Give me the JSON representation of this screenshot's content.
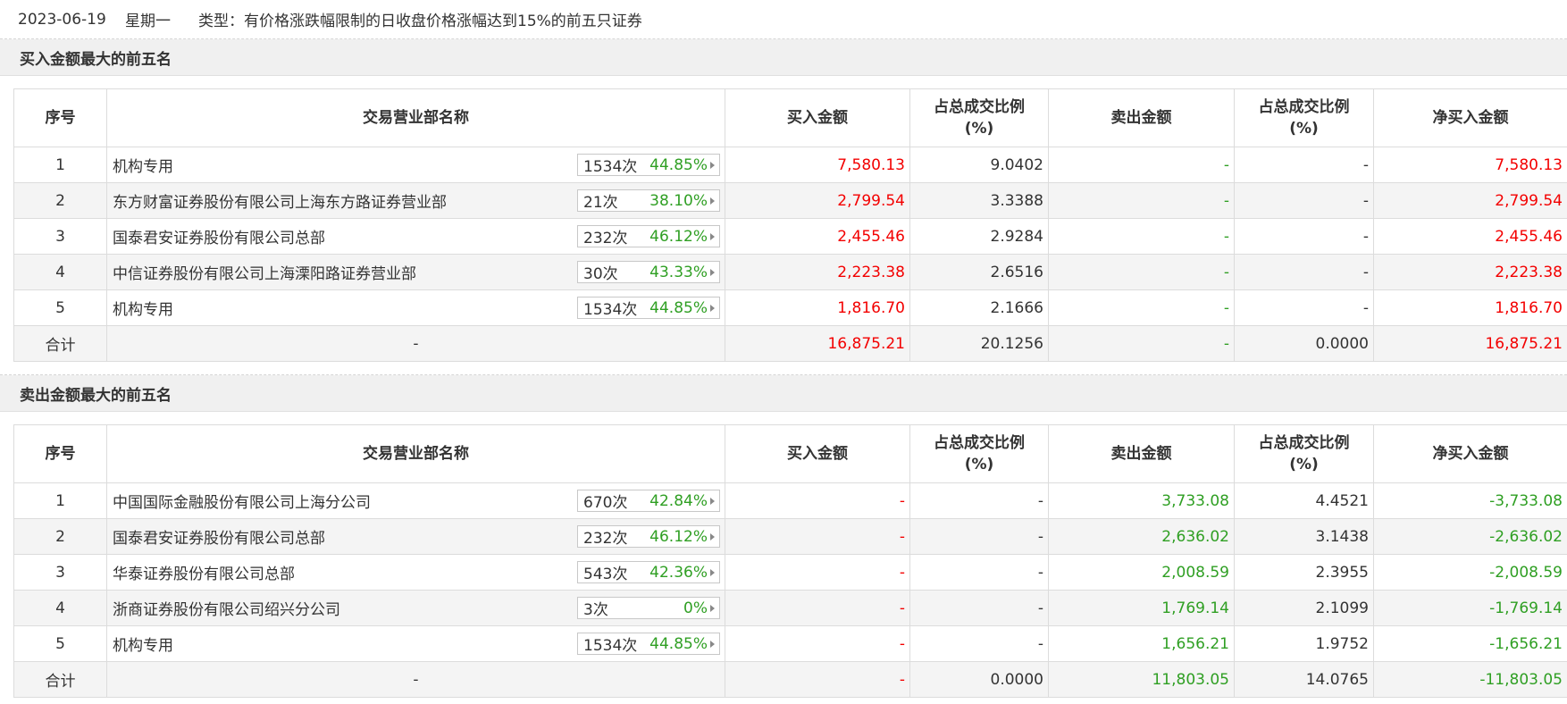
{
  "header": {
    "date": "2023-06-19",
    "weekday": "星期一",
    "type_text": "类型：有价格涨跌幅限制的日收盘价格涨幅达到15%的前五只证券"
  },
  "columns": {
    "seq": "序号",
    "name": "交易营业部名称",
    "buy": "买入金额",
    "buy_ratio_l1": "占总成交比例",
    "buy_ratio_l2": "(%)",
    "sell": "卖出金额",
    "sell_ratio_l1": "占总成交比例",
    "sell_ratio_l2": "(%)",
    "net": "净买入金额"
  },
  "colors": {
    "red": "#f30000",
    "green": "#2f9f23",
    "header_bg": "#f0f0f0"
  },
  "buy_section": {
    "title": "买入金额最大的前五名",
    "rows": [
      {
        "seq": "1",
        "name": "机构专用",
        "count": "1534次",
        "rate": "44.85%",
        "buy": "7,580.13",
        "buy_ratio": "9.0402",
        "sell": "-",
        "sell_ratio": "-",
        "net": "7,580.13"
      },
      {
        "seq": "2",
        "name": "东方财富证券股份有限公司上海东方路证券营业部",
        "count": "21次",
        "rate": "38.10%",
        "buy": "2,799.54",
        "buy_ratio": "3.3388",
        "sell": "-",
        "sell_ratio": "-",
        "net": "2,799.54"
      },
      {
        "seq": "3",
        "name": "国泰君安证券股份有限公司总部",
        "count": "232次",
        "rate": "46.12%",
        "buy": "2,455.46",
        "buy_ratio": "2.9284",
        "sell": "-",
        "sell_ratio": "-",
        "net": "2,455.46"
      },
      {
        "seq": "4",
        "name": "中信证券股份有限公司上海溧阳路证券营业部",
        "count": "30次",
        "rate": "43.33%",
        "buy": "2,223.38",
        "buy_ratio": "2.6516",
        "sell": "-",
        "sell_ratio": "-",
        "net": "2,223.38"
      },
      {
        "seq": "5",
        "name": "机构专用",
        "count": "1534次",
        "rate": "44.85%",
        "buy": "1,816.70",
        "buy_ratio": "2.1666",
        "sell": "-",
        "sell_ratio": "-",
        "net": "1,816.70"
      }
    ],
    "total": {
      "label": "合计",
      "name": "-",
      "buy": "16,875.21",
      "buy_ratio": "20.1256",
      "sell": "-",
      "sell_ratio": "0.0000",
      "net": "16,875.21"
    }
  },
  "sell_section": {
    "title": "卖出金额最大的前五名",
    "rows": [
      {
        "seq": "1",
        "name": "中国国际金融股份有限公司上海分公司",
        "count": "670次",
        "rate": "42.84%",
        "buy": "-",
        "buy_ratio": "-",
        "sell": "3,733.08",
        "sell_ratio": "4.4521",
        "net": "-3,733.08"
      },
      {
        "seq": "2",
        "name": "国泰君安证券股份有限公司总部",
        "count": "232次",
        "rate": "46.12%",
        "buy": "-",
        "buy_ratio": "-",
        "sell": "2,636.02",
        "sell_ratio": "3.1438",
        "net": "-2,636.02"
      },
      {
        "seq": "3",
        "name": "华泰证券股份有限公司总部",
        "count": "543次",
        "rate": "42.36%",
        "buy": "-",
        "buy_ratio": "-",
        "sell": "2,008.59",
        "sell_ratio": "2.3955",
        "net": "-2,008.59"
      },
      {
        "seq": "4",
        "name": "浙商证券股份有限公司绍兴分公司",
        "count": "3次",
        "rate": "0%",
        "buy": "-",
        "buy_ratio": "-",
        "sell": "1,769.14",
        "sell_ratio": "2.1099",
        "net": "-1,769.14"
      },
      {
        "seq": "5",
        "name": "机构专用",
        "count": "1534次",
        "rate": "44.85%",
        "buy": "-",
        "buy_ratio": "-",
        "sell": "1,656.21",
        "sell_ratio": "1.9752",
        "net": "-1,656.21"
      }
    ],
    "total": {
      "label": "合计",
      "name": "-",
      "buy": "-",
      "buy_ratio": "0.0000",
      "sell": "11,803.05",
      "sell_ratio": "14.0765",
      "net": "-11,803.05"
    }
  }
}
